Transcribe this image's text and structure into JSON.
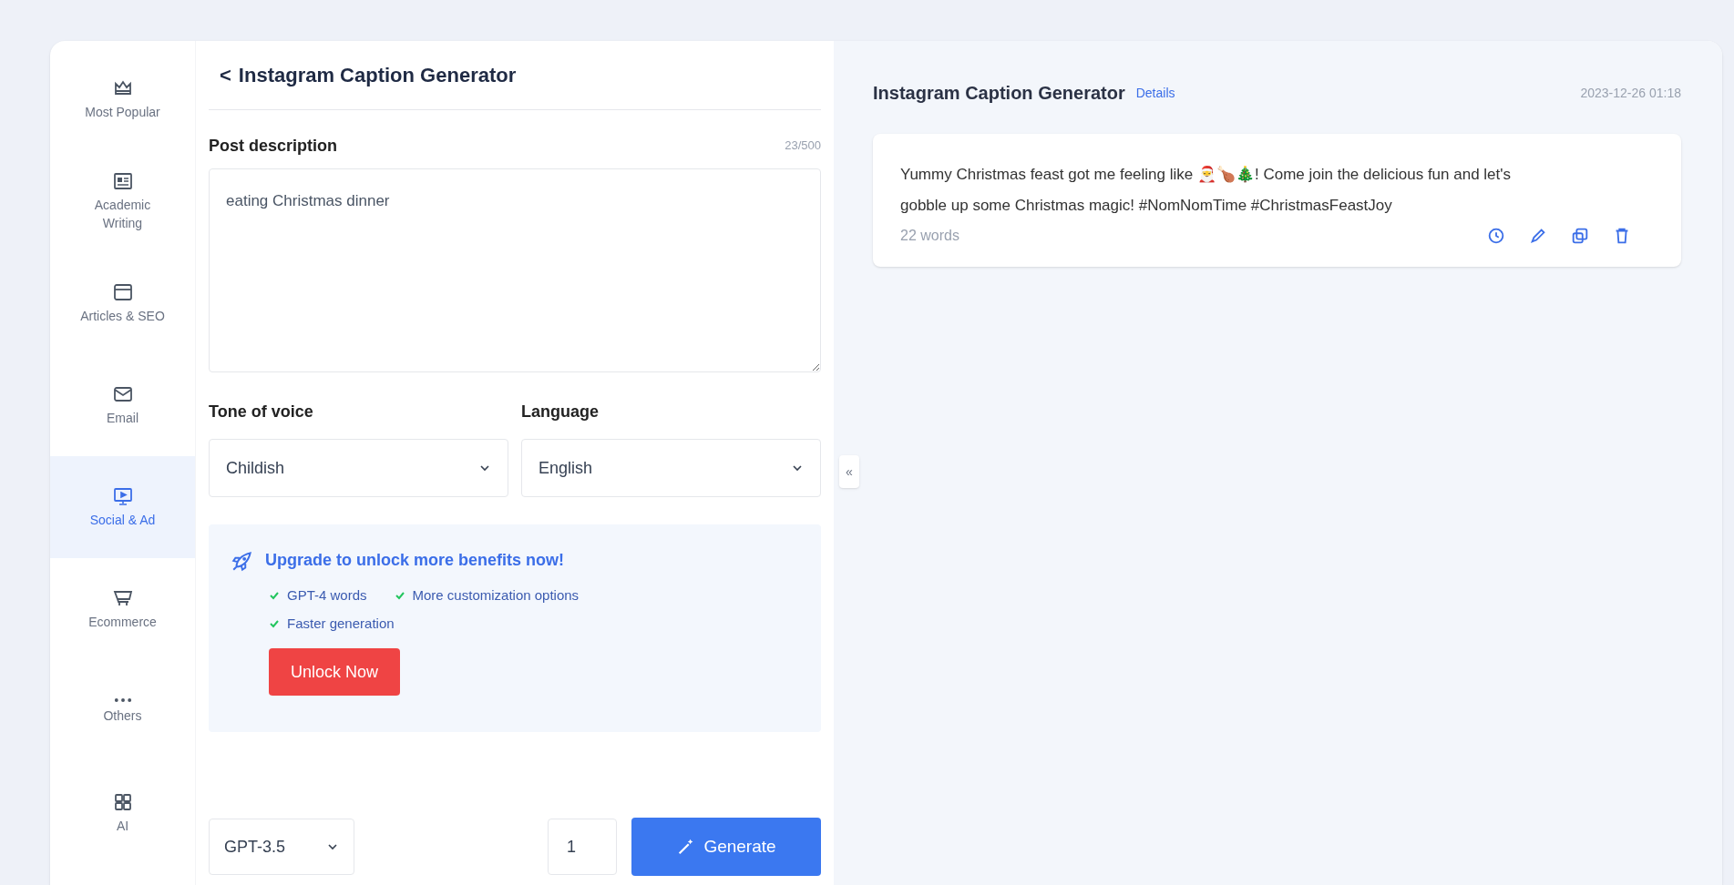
{
  "sidebar": {
    "items": [
      {
        "label": "Most Popular",
        "selected": false
      },
      {
        "label": "Academic Writing",
        "selected": false
      },
      {
        "label": "Articles & SEO",
        "selected": false
      },
      {
        "label": "Email",
        "selected": false
      },
      {
        "label": "Social & Ad",
        "selected": true
      },
      {
        "label": "Ecommerce",
        "selected": false
      },
      {
        "label": "Others",
        "selected": false
      },
      {
        "label": "AI",
        "selected": false
      }
    ]
  },
  "form": {
    "back_icon": "<",
    "title": "Instagram Caption Generator",
    "description": {
      "label": "Post description",
      "counter": "23/500",
      "value": "eating Christmas dinner"
    },
    "selects": [
      {
        "label": "Tone of voice",
        "value": "Childish"
      },
      {
        "label": "Language",
        "value": "English"
      }
    ],
    "upgrade": {
      "title": "Upgrade to unlock more benefits now!",
      "benefits": [
        "GPT-4 words",
        "More customization options",
        "Faster generation"
      ],
      "button": "Unlock Now"
    },
    "model": "GPT-3.5",
    "count": "1",
    "generate": "Generate"
  },
  "collapse": "«",
  "result": {
    "title": "Instagram Caption Generator",
    "details": "Details",
    "date": "2023-12-26 01:18",
    "text": "Yummy Christmas feast got me feeling like 🎅🍗🎄! Come join the delicious fun and let's gobble up some Christmas magic! #NomNomTime #ChristmasFeastJoy",
    "words": "22 words"
  }
}
